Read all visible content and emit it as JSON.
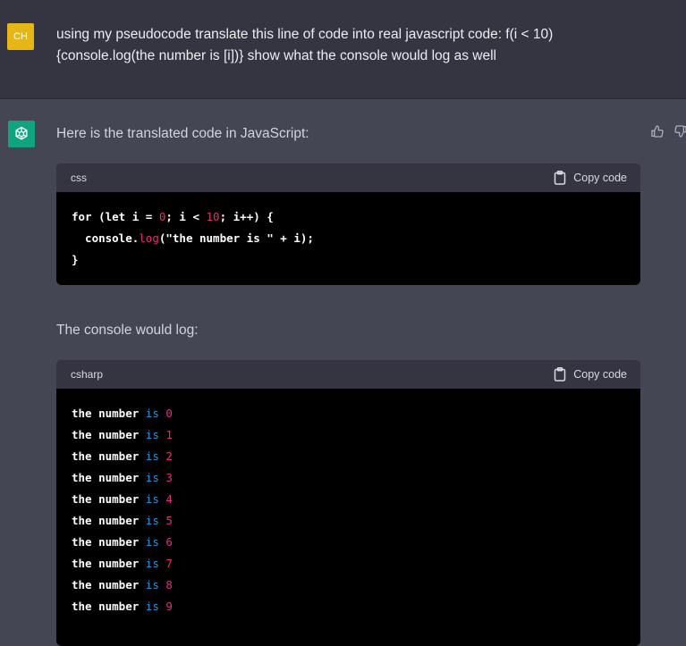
{
  "user": {
    "avatar_initials": "CH",
    "message": "using my pseudocode translate this line of code into real javascript code: f(i < 10) {console.log(the number is [i])} show what the console would log as well"
  },
  "assistant": {
    "intro": "Here is the translated code in JavaScript:",
    "console_intro": "The console would log:",
    "code1": {
      "language": "css",
      "copy_label": "Copy code",
      "lines": [
        {
          "p1": "for (let i = ",
          "n1": "0",
          "p2": "; i < ",
          "n2": "10",
          "p3": "; i++) {"
        },
        {
          "p1": "  console",
          "dot": ".",
          "fn": "log",
          "p2": "(\"the number is \" + i);"
        },
        {
          "p1": "}"
        }
      ]
    },
    "code2": {
      "language": "csharp",
      "copy_label": "Copy code",
      "lines": [
        {
          "pre": "the number ",
          "kw": "is",
          "num": "0"
        },
        {
          "pre": "the number ",
          "kw": "is",
          "num": "1"
        },
        {
          "pre": "the number ",
          "kw": "is",
          "num": "2"
        },
        {
          "pre": "the number ",
          "kw": "is",
          "num": "3"
        },
        {
          "pre": "the number ",
          "kw": "is",
          "num": "4"
        },
        {
          "pre": "the number ",
          "kw": "is",
          "num": "5"
        },
        {
          "pre": "the number ",
          "kw": "is",
          "num": "6"
        },
        {
          "pre": "the number ",
          "kw": "is",
          "num": "7"
        },
        {
          "pre": "the number ",
          "kw": "is",
          "num": "8"
        },
        {
          "pre": "the number ",
          "kw": "is",
          "num": "9"
        }
      ]
    }
  },
  "colors": {
    "accent_number": "#df3079",
    "accent_keyword": "#2e95d3",
    "user_avatar": "#e5b617",
    "assistant_avatar": "#10a37f"
  },
  "icons": [
    "openai-logo-icon",
    "thumbs-up-icon",
    "thumbs-down-icon",
    "clipboard-icon"
  ]
}
